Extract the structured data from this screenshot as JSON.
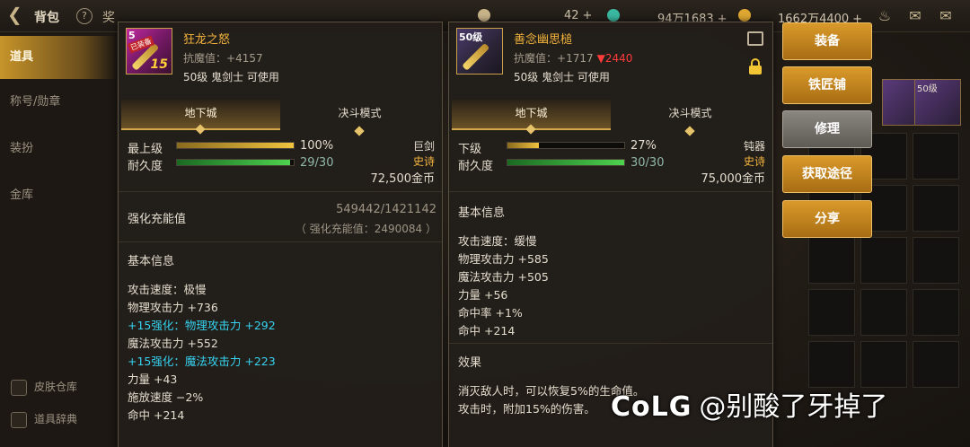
{
  "topbar": {
    "back_icon": "back-arrow-icon",
    "title": "背包",
    "help": "?",
    "cut_text": "奖",
    "currencies": [
      {
        "name": "clover",
        "value": "42",
        "color": "#c9b48a"
      },
      {
        "name": "gem",
        "value": "94万1683",
        "color": "#3ab8a0"
      },
      {
        "name": "gold",
        "value": "1662万4400",
        "color": "#e0a832"
      }
    ],
    "plus": "+"
  },
  "sidebar": {
    "items": [
      {
        "label": "道具",
        "active": true
      },
      {
        "label": "称号/勋章"
      },
      {
        "label": "装扮"
      },
      {
        "label": "金库"
      }
    ],
    "bottom": [
      {
        "label": "皮肤仓库"
      },
      {
        "label": "道具辞典"
      }
    ]
  },
  "panel_left": {
    "thumb_level": "5",
    "thumb_badge": "已装备",
    "thumb_enhance": "15",
    "name": "狂龙之怒",
    "resist_label": "抗魔值：",
    "resist_value": "+4157",
    "requirement": "50级 鬼剑士 可使用",
    "tabs": [
      {
        "label": "地下城",
        "active": true
      },
      {
        "label": "决斗模式"
      }
    ],
    "stat1_label": "最上级",
    "stat1_pct": "100%",
    "stat1_fill": 1.0,
    "stat2_label": "耐久度",
    "stat2_val": "29/30",
    "stat2_fill": 0.967,
    "weapon_type": "巨剑",
    "rarity": "史诗",
    "price": "72,500金币",
    "charge_title": "强化充能值",
    "charge_value": "549442/1421142",
    "charge_sub": "（ 强化充能值：2490084 ）",
    "info_title": "基本信息",
    "info_lines": [
      {
        "text": "攻击速度：极慢"
      },
      {
        "text": "物理攻击力 +736"
      },
      {
        "text": "+15强化：物理攻击力 +292",
        "cyan": true
      },
      {
        "text": "魔法攻击力 +552"
      },
      {
        "text": "+15强化：魔法攻击力 +223",
        "cyan": true
      },
      {
        "text": "力量 +43"
      },
      {
        "text": "施放速度 −2%"
      },
      {
        "text": "命中 +214"
      }
    ]
  },
  "panel_right": {
    "thumb_level": "50级",
    "name": "善念幽思槌",
    "resist_label": "抗魔值：",
    "resist_value": "+1717",
    "resist_down": "▼2440",
    "requirement": "50级 鬼剑士 可使用",
    "tabs": [
      {
        "label": "地下城",
        "active": true
      },
      {
        "label": "决斗模式"
      }
    ],
    "stat1_label": "下级",
    "stat1_pct": "27%",
    "stat1_fill": 0.27,
    "stat2_label": "耐久度",
    "stat2_val": "30/30",
    "stat2_fill": 1.0,
    "weapon_type": "钝器",
    "rarity": "史诗",
    "price": "75,000金币",
    "info_title": "基本信息",
    "info_lines": [
      {
        "text": "攻击速度：缓慢"
      },
      {
        "text": "物理攻击力 +585"
      },
      {
        "text": "魔法攻击力 +505"
      },
      {
        "text": "力量 +56"
      },
      {
        "text": "命中率 +1%"
      },
      {
        "text": "命中 +214"
      }
    ],
    "effect_title": "效果",
    "effect_lines": [
      {
        "text": "消灭敌人时，可以恢复5%的生命值。"
      },
      {
        "text": "攻击时，附加15%的伤害。"
      }
    ]
  },
  "actions": [
    {
      "label": "装备"
    },
    {
      "label": "铁匠铺"
    },
    {
      "label": "修理",
      "gray": true
    },
    {
      "label": "获取途径"
    },
    {
      "label": "分享"
    }
  ],
  "grid_lv": "50级",
  "watermark": {
    "logo": "CoLG",
    "text": "@别酸了牙掉了"
  }
}
